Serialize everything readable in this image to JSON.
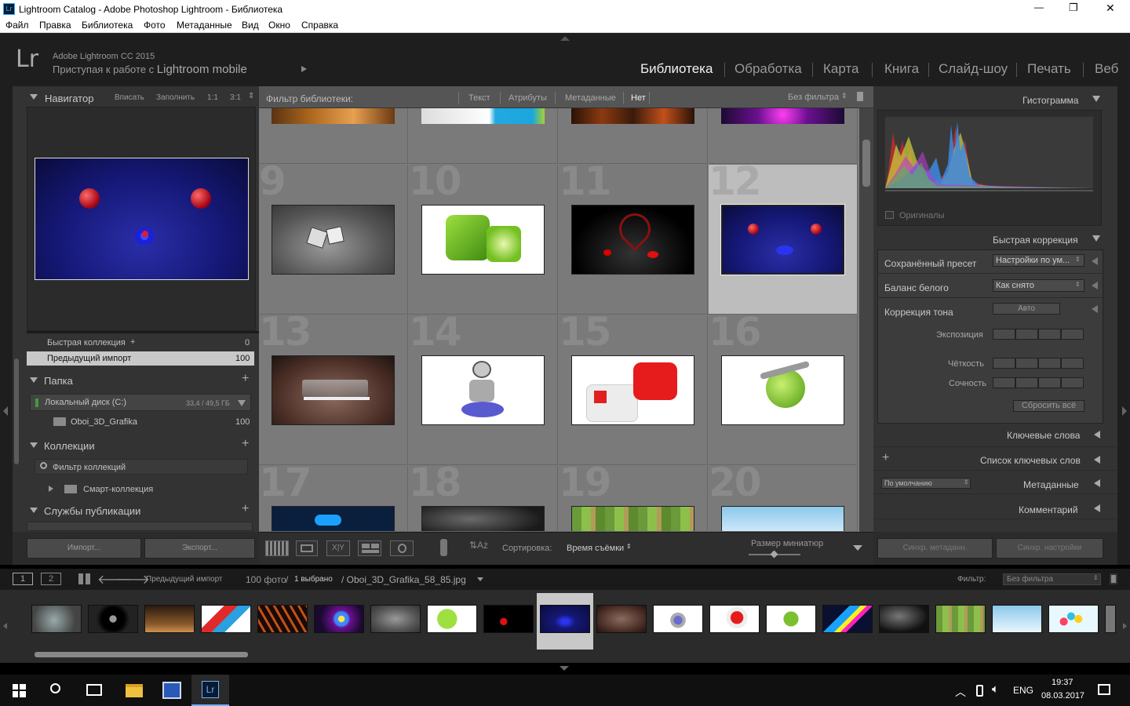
{
  "window": {
    "title": "Lightroom Catalog - Adobe Photoshop Lightroom - Библиотека",
    "min": "—",
    "max": "❐",
    "close": "✕"
  },
  "menu": [
    "Файл",
    "Правка",
    "Библиотека",
    "Фото",
    "Метаданные",
    "Вид",
    "Окно",
    "Справка"
  ],
  "identity": {
    "logo": "Lr",
    "product": "Adobe Lightroom CC 2015",
    "tagline_prefix": "Приступая к работе с",
    "tagline_app": "Lightroom mobile"
  },
  "modules": [
    "Библиотека",
    "Обработка",
    "Карта",
    "Книга",
    "Слайд-шоу",
    "Печать",
    "Веб"
  ],
  "navigator": {
    "title": "Навигатор",
    "opts": [
      "Вписать",
      "Заполнить",
      "1:1",
      "3:1"
    ]
  },
  "catalog": {
    "quick": "Быстрая коллекция",
    "quick_plus": "+",
    "quick_count": "0",
    "prev": "Предыдущий импорт",
    "prev_count": "100"
  },
  "folders": {
    "title": "Папка",
    "disk": "Локальный диск (C:)",
    "disk_size": "33,4 / 49,5 ГБ",
    "folder": "Oboi_3D_Grafika",
    "folder_count": "100"
  },
  "collections": {
    "title": "Коллекции",
    "filter": "Фильтр коллекций",
    "smart": "Смарт-коллекция"
  },
  "publish": {
    "title": "Службы публикации"
  },
  "left_buttons": {
    "import": "Импорт...",
    "export": "Экспорт..."
  },
  "filterbar": {
    "label": "Фильтр библиотеки:",
    "opts": [
      "Текст",
      "Атрибуты",
      "Метаданные",
      "Нет"
    ],
    "preset": "Без фильтра"
  },
  "grid_numbers": [
    "9",
    "10",
    "11",
    "12",
    "13",
    "14",
    "15",
    "16",
    "17",
    "18",
    "19",
    "20"
  ],
  "toolbar": {
    "sort_label": "Сортировка:",
    "sort_value": "Время съёмки",
    "thumb_label": "Размер миниатюр"
  },
  "histogram": {
    "title": "Гистограмма",
    "originals": "Оригиналы"
  },
  "quickdev": {
    "title": "Быстрая коррекция",
    "preset_label": "Сохранённый пресет",
    "preset_value": "Настройки по ум...",
    "wb_label": "Баланс белого",
    "wb_value": "Как снято",
    "tone_label": "Коррекция тона",
    "auto": "Авто",
    "exposure": "Экспозиция",
    "clarity": "Чёткость",
    "vibrance": "Сочность",
    "reset": "Сбросить всё"
  },
  "right_sections": {
    "keywords": "Ключевые слова",
    "keyword_list": "Список ключевых слов",
    "metadata": "Метаданные",
    "metadata_preset": "По умолчанию",
    "comments": "Комментарий"
  },
  "right_buttons": {
    "sync_meta": "Синхр. метаданн.",
    "sync_settings": "Синхр. настройки"
  },
  "filmstrip_bar": {
    "screen1": "1",
    "screen2": "2",
    "source": "Предыдущий импорт",
    "count": "100 фото",
    "selected": "1 выбрано",
    "file": "/ Oboi_3D_Grafika_58_85.jpg",
    "filter_label": "Фильтр:",
    "filter_value": "Без фильтра"
  },
  "taskbar": {
    "lang": "ENG",
    "time": "19:37",
    "date": "08.03.2017"
  }
}
